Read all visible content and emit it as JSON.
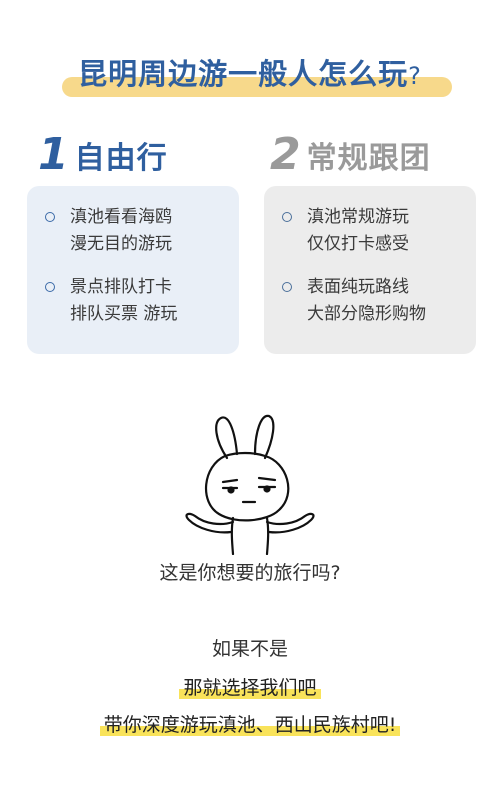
{
  "title": {
    "main": "昆明周边游一般人怎么玩",
    "question_mark": "?"
  },
  "columns": [
    {
      "number": "1",
      "heading": "自由行",
      "items": [
        {
          "lines": [
            "滇池看看海鸥",
            "漫无目的游玩"
          ]
        },
        {
          "lines": [
            "景点排队打卡",
            "排队买票 游玩"
          ]
        }
      ]
    },
    {
      "number": "2",
      "heading": "常规跟团",
      "items": [
        {
          "lines": [
            "滇池常规游玩",
            "仅仅打卡感受"
          ]
        },
        {
          "lines": [
            "表面纯玩路线",
            "大部分隐形购物"
          ]
        }
      ]
    }
  ],
  "illustration": {
    "icon": "shrugging-rabbit-icon"
  },
  "question": "这是你想要的旅行吗?",
  "closing": {
    "line1": "如果不是",
    "line2": "那就选择我们吧",
    "line3": "带你深度游玩滇池、西山民族村吧!"
  },
  "colors": {
    "title_blue": "#2f5f9f",
    "title_highlight": "#f7d98b",
    "card1_bg": "#e9eff7",
    "card2_bg": "#ececec",
    "text_highlight": "#f9e35a"
  }
}
